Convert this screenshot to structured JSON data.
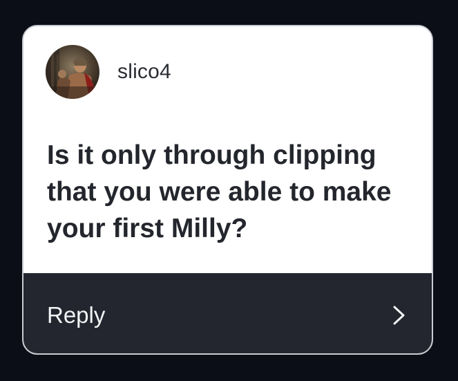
{
  "card": {
    "username": "slico4",
    "avatar_icon": "profile-avatar",
    "question": "Is it only through clipping that you were able to make your first Milly?",
    "reply_label": "Reply",
    "reply_icon": "chevron-right-icon"
  },
  "colors": {
    "background": "#0b0e17",
    "card": "#ffffff",
    "reply_bar": "#23262e",
    "text_dark": "#24262d",
    "text_light": "#f2f3f5"
  }
}
